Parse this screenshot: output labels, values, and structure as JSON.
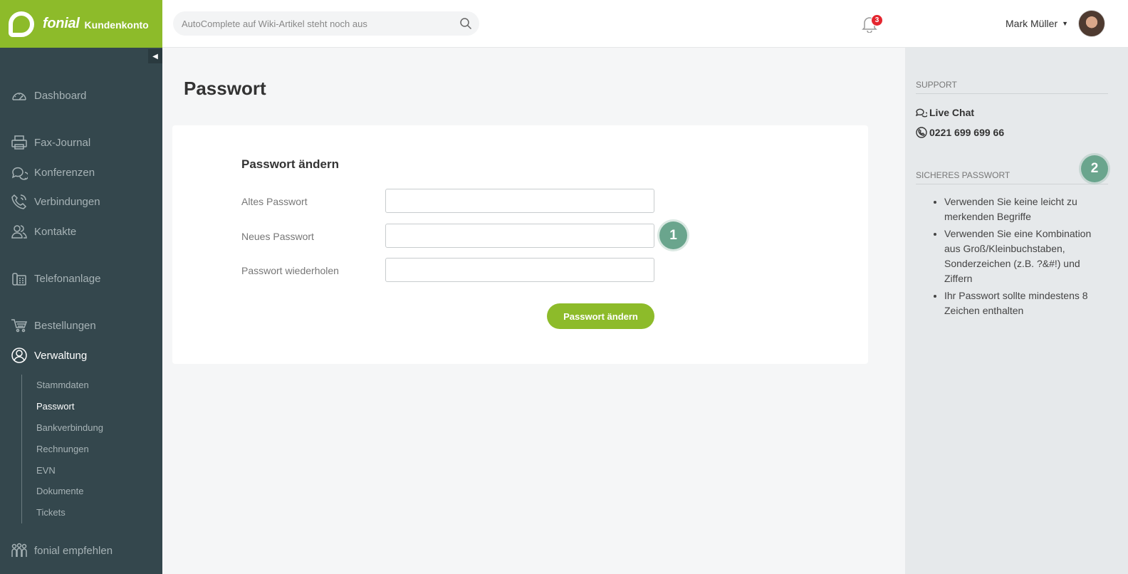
{
  "brand": {
    "name": "fonial",
    "sub": "Kundenkonto",
    "accent": "#8dbb2a"
  },
  "sidebar": {
    "collapse_glyph": "◀",
    "items": [
      {
        "id": "dashboard",
        "label": "Dashboard",
        "icon": "gauge-icon"
      },
      {
        "id": "fax",
        "label": "Fax-Journal",
        "icon": "printer-icon"
      },
      {
        "id": "konferenzen",
        "label": "Konferenzen",
        "icon": "chat-bubbles-icon"
      },
      {
        "id": "verbindungen",
        "label": "Verbindungen",
        "icon": "phone-icon"
      },
      {
        "id": "kontakte",
        "label": "Kontakte",
        "icon": "contacts-icon"
      },
      {
        "id": "telefonanlage",
        "label": "Telefonanlage",
        "icon": "desk-phone-icon"
      },
      {
        "id": "bestellungen",
        "label": "Bestellungen",
        "icon": "cart-icon"
      },
      {
        "id": "verwaltung",
        "label": "Verwaltung",
        "icon": "user-circle-icon"
      },
      {
        "id": "empfehlen",
        "label": "fonial empfehlen",
        "icon": "people-icon"
      }
    ],
    "subitems": [
      "Stammdaten",
      "Passwort",
      "Bankverbindung",
      "Rechnungen",
      "EVN",
      "Dokumente",
      "Tickets"
    ]
  },
  "header": {
    "search_placeholder": "AutoComplete auf Wiki-Artikel steht noch aus",
    "notifications": "3",
    "user_name": "Mark Müller"
  },
  "main": {
    "title": "Passwort",
    "card_title": "Passwort ändern",
    "labels": {
      "old": "Altes Passwort",
      "new": "Neues Passwort",
      "repeat": "Passwort wiederholen"
    },
    "submit": "Passwort ändern",
    "marker1": "1"
  },
  "support": {
    "heading": "SUPPORT",
    "chat": "Live Chat",
    "phone": "0221 699 699 66",
    "secure_heading": "SICHERES PASSWORT",
    "marker2": "2",
    "tips": [
      "Verwenden Sie keine leicht zu merkenden Begriffe",
      "Verwenden Sie eine Kombination aus Groß/Kleinbuchstaben, Sonderzeichen (z.B. ?&#!) und Ziffern",
      "Ihr Passwort sollte mindestens 8 Zeichen enthalten"
    ]
  }
}
